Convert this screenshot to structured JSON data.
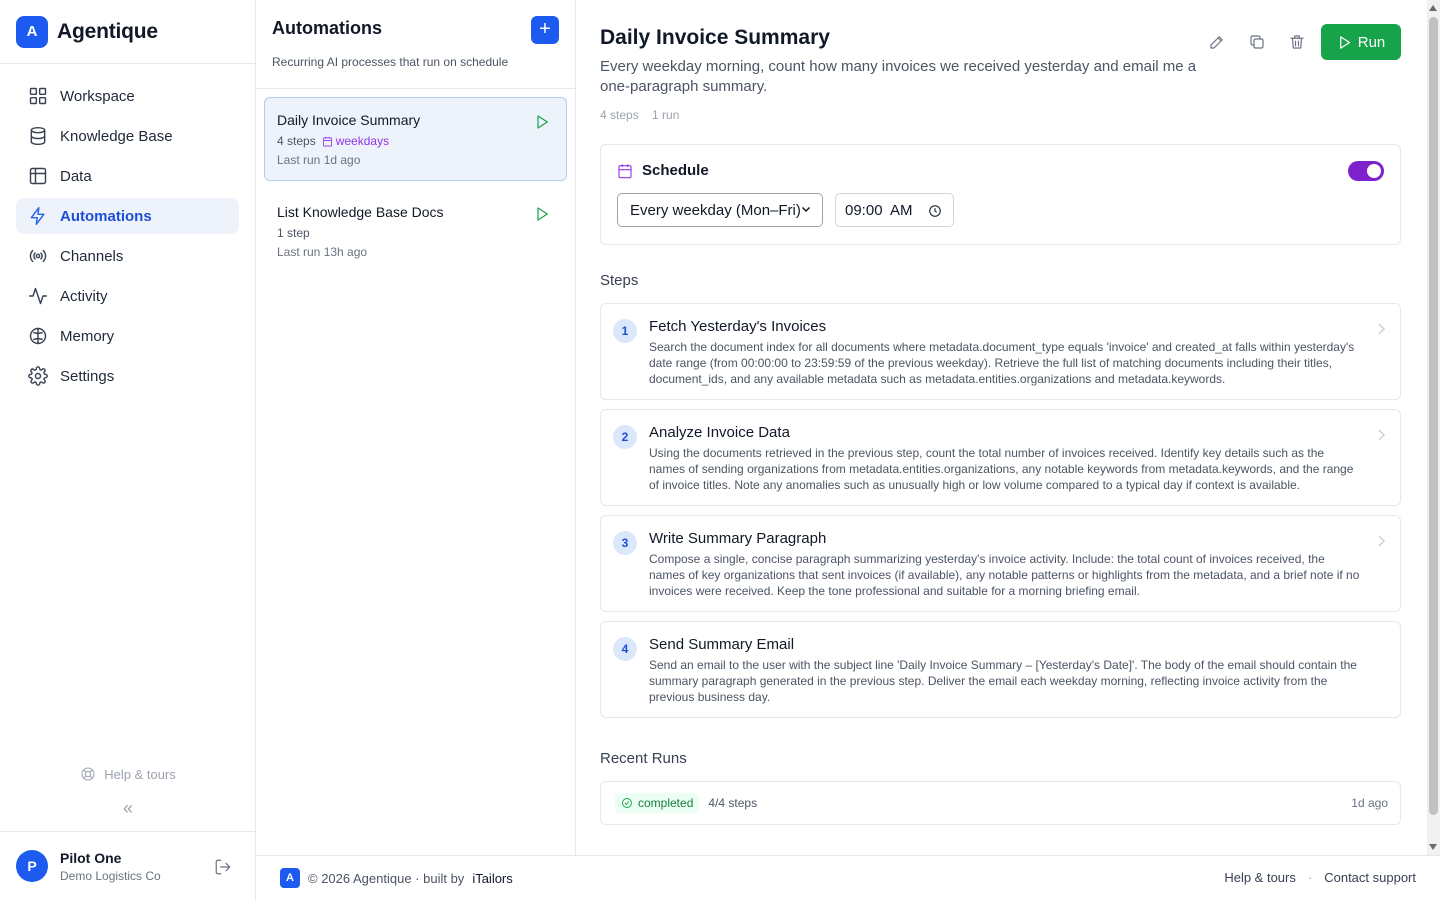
{
  "brand": {
    "logo_letter": "A",
    "name": "Agentique",
    "color": "#1d5bf0"
  },
  "nav": {
    "items": [
      {
        "label": "Workspace",
        "icon": "grid-icon"
      },
      {
        "label": "Knowledge Base",
        "icon": "database-icon"
      },
      {
        "label": "Data",
        "icon": "table-icon"
      },
      {
        "label": "Automations",
        "icon": "lightning-icon",
        "active": true
      },
      {
        "label": "Channels",
        "icon": "broadcast-icon"
      },
      {
        "label": "Activity",
        "icon": "activity-icon"
      },
      {
        "label": "Memory",
        "icon": "brain-icon"
      },
      {
        "label": "Settings",
        "icon": "gear-icon"
      }
    ],
    "help_tours": "Help & tours",
    "collapse": "«"
  },
  "user": {
    "initial": "P",
    "name": "Pilot One",
    "org": "Demo Logistics Co"
  },
  "automations_panel": {
    "title": "Automations",
    "subtitle": "Recurring AI processes that run on schedule",
    "add_label": "+",
    "items": [
      {
        "name": "Daily Invoice Summary",
        "steps": "4 steps",
        "schedule": "weekdays",
        "last_run": "Last run 1d ago",
        "selected": true
      },
      {
        "name": "List Knowledge Base Docs",
        "steps": "1 step",
        "schedule": "",
        "last_run": "Last run 13h ago",
        "selected": false
      }
    ]
  },
  "detail": {
    "title": "Daily Invoice Summary",
    "description": "Every weekday morning, count how many invoices we received yesterday and email me a one-paragraph summary.",
    "steps_count": "4 steps",
    "runs_count": "1 run",
    "run_label": "Run",
    "schedule": {
      "label": "Schedule",
      "enabled": true,
      "frequency": "Every weekday (Mon–Fri)",
      "time": "09:00  AM"
    },
    "steps_label": "Steps",
    "steps": [
      {
        "num": "1",
        "title": "Fetch Yesterday's Invoices",
        "body": "Search the document index for all documents where metadata.document_type equals 'invoice' and created_at falls within yesterday's date range (from 00:00:00 to 23:59:59 of the previous weekday). Retrieve the full list of matching documents including their titles, document_ids, and any available metadata such as metadata.entities.organizations and metadata.keywords."
      },
      {
        "num": "2",
        "title": "Analyze Invoice Data",
        "body": "Using the documents retrieved in the previous step, count the total number of invoices received. Identify key details such as the names of sending organizations from metadata.entities.organizations, any notable keywords from metadata.keywords, and the range of invoice titles. Note any anomalies such as unusually high or low volume compared to a typical day if context is available."
      },
      {
        "num": "3",
        "title": "Write Summary Paragraph",
        "body": "Compose a single, concise paragraph summarizing yesterday's invoice activity. Include: the total count of invoices received, the names of key organizations that sent invoices (if available), any notable patterns or highlights from the metadata, and a brief note if no invoices were received. Keep the tone professional and suitable for a morning briefing email."
      },
      {
        "num": "4",
        "title": "Send Summary Email",
        "body": "Send an email to the user with the subject line 'Daily Invoice Summary – [Yesterday's Date]'. The body of the email should contain the summary paragraph generated in the previous step. Deliver the email each weekday morning, reflecting invoice activity from the previous business day."
      }
    ],
    "recent_runs_label": "Recent Runs",
    "runs": [
      {
        "status": "completed",
        "progress": "4/4 steps",
        "time": "1d ago"
      }
    ]
  },
  "footer": {
    "logo_letter": "A",
    "copyright": "© 2026 Agentique · built by",
    "builder": "iTailors",
    "links": [
      "Help & tours",
      "Contact support"
    ]
  }
}
